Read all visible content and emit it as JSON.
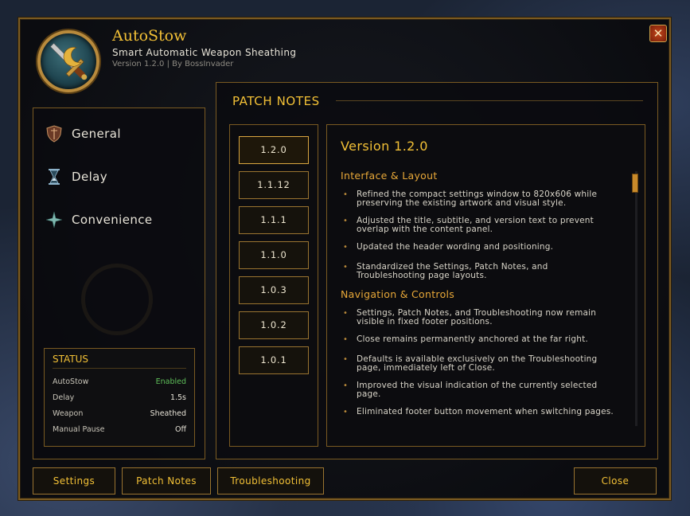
{
  "header": {
    "title": "AutoStow",
    "subtitle": "Smart Automatic Weapon Sheathing",
    "version_line": "Version 1.2.0 | By BossInvader",
    "close_icon": "✕"
  },
  "sidebar": {
    "items": [
      {
        "label": "General",
        "icon": "shield-icon"
      },
      {
        "label": "Delay",
        "icon": "hourglass-icon"
      },
      {
        "label": "Convenience",
        "icon": "sparkle-icon"
      }
    ],
    "status": {
      "title": "STATUS",
      "rows": [
        {
          "label": "AutoStow",
          "value": "Enabled"
        },
        {
          "label": "Delay",
          "value": "1.5s"
        },
        {
          "label": "Weapon",
          "value": "Sheathed"
        },
        {
          "label": "Manual Pause",
          "value": "Off"
        }
      ]
    }
  },
  "main": {
    "title": "PATCH NOTES",
    "versions": [
      "1.2.0",
      "1.1.12",
      "1.1.1",
      "1.1.0",
      "1.0.3",
      "1.0.2",
      "1.0.1"
    ],
    "selected_version": "1.2.0",
    "notes": {
      "title": "Version 1.2.0",
      "sections": [
        {
          "heading": "Interface & Layout",
          "bullets": [
            "Refined the compact settings window to 820x606 while preserving the existing artwork and visual style.",
            "Adjusted the title, subtitle, and version text to prevent overlap with the content panel.",
            "Updated the header wording and positioning.",
            "Standardized the Settings, Patch Notes, and Troubleshooting page layouts."
          ]
        },
        {
          "heading": "Navigation & Controls",
          "bullets": [
            "Settings, Patch Notes, and Troubleshooting now remain visible in fixed footer positions.",
            "Close remains permanently anchored at the far right.",
            "Defaults is available exclusively on the Troubleshooting page, immediately left of Close.",
            "Improved the visual indication of the currently selected page.",
            "Eliminated footer button movement when switching pages."
          ]
        }
      ]
    }
  },
  "footer": {
    "settings": "Settings",
    "patch_notes": "Patch Notes",
    "troubleshooting": "Troubleshooting",
    "close": "Close"
  },
  "colors": {
    "gold": "#f2c036",
    "border": "#7a5a22",
    "enabled": "#5fbf5a"
  }
}
